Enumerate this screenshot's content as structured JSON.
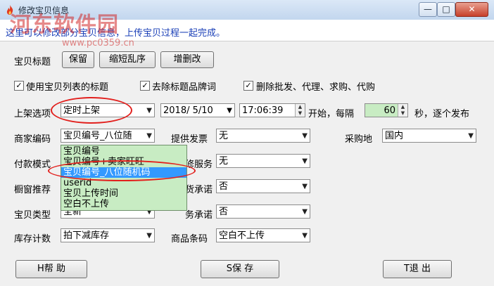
{
  "window": {
    "title": "修改宝贝信息",
    "buttons": {
      "minimize": "—",
      "maximize": "□",
      "close": "✕"
    }
  },
  "info": "这里可以修改部分宝贝信息，上传宝贝过程一起完成。",
  "watermark": {
    "brand": "河东软件园",
    "url": "www.pc0359.cn"
  },
  "title_row": {
    "label": "宝贝标题",
    "buttons": [
      "保留",
      "缩短乱序",
      "增删改"
    ]
  },
  "checkboxes": [
    {
      "label": "使用宝贝列表的标题",
      "checked": true
    },
    {
      "label": "去除标题品牌词",
      "checked": true
    },
    {
      "label": "删除批发、代理、求购、代购",
      "checked": true
    }
  ],
  "listing": {
    "label": "上架选项",
    "option": "定时上架",
    "date": "2018/ 5/10",
    "time": "17:06:39",
    "start_label": "开始，每隔",
    "interval": "60",
    "suffix": "秒，逐个发布"
  },
  "merchant_code": {
    "label": "商家编码",
    "value": "宝贝编号_八位随"
  },
  "invoice": {
    "label": "提供发票",
    "value": "无"
  },
  "purchase_place": {
    "label": "采购地",
    "value": "国内"
  },
  "payment": {
    "label": "付款模式"
  },
  "warranty": {
    "label": "保修服务",
    "visible_label": "修服务",
    "value": "无"
  },
  "showcase": {
    "label": "橱窗推荐"
  },
  "return_promise": {
    "label": "退货承诺",
    "visible_label": "货承诺",
    "value": "否"
  },
  "item_type": {
    "label": "宝贝类型",
    "value": "全新"
  },
  "service_promise": {
    "label": "服务承诺",
    "visible_label": "务承诺",
    "value": "否"
  },
  "stock": {
    "label": "库存计数",
    "value": "拍下减库存"
  },
  "barcode": {
    "label": "商品条码",
    "value": "空白不上传"
  },
  "dropdown_options": [
    "宝贝编号",
    "宝贝编号+卖家旺旺",
    "宝贝编号_八位随机码",
    "userid",
    "宝贝上传时间",
    "空白不上传"
  ],
  "dropdown_selected_index": 2,
  "footer": {
    "help": "H帮  助",
    "save": "S保  存",
    "exit": "T退  出"
  },
  "colors": {
    "accent": "#3399ff",
    "annotation": "#e2201d",
    "dropdown_bg": "#c8ecc3",
    "info_text": "#1a3fb7"
  },
  "icons": {
    "app": "flame-icon"
  }
}
